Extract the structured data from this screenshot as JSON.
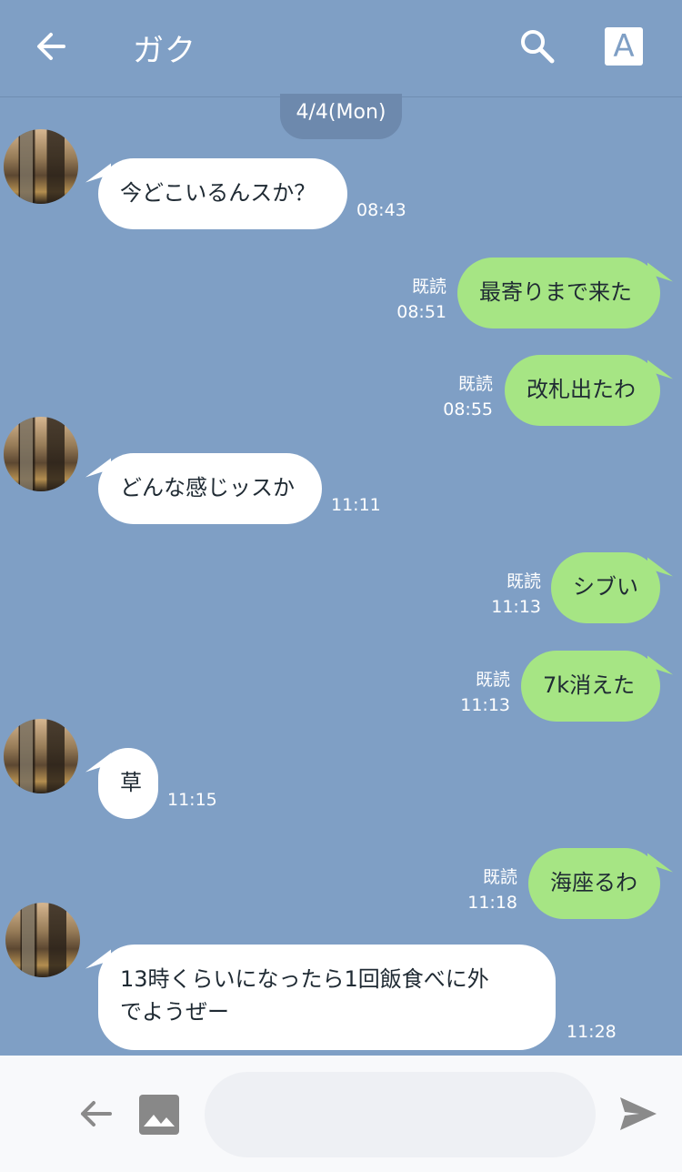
{
  "header": {
    "title": "ガク",
    "font_button_label": "A",
    "back_icon": "arrow-left-icon",
    "search_icon": "search-icon"
  },
  "date_separator": "4/4(Mon)",
  "messages": [
    {
      "side": "in",
      "text": "今どこいるんスか？",
      "time": "08:43"
    },
    {
      "side": "out",
      "text": "最寄りまで来た",
      "read": "既読",
      "time": "08:51"
    },
    {
      "side": "out",
      "text": "改札出たわ",
      "read": "既読",
      "time": "08:55"
    },
    {
      "side": "in",
      "text": "どんな感じッスか",
      "time": "11:11"
    },
    {
      "side": "out",
      "text": "シブい",
      "read": "既読",
      "time": "11:13"
    },
    {
      "side": "out",
      "text": "7k消えた",
      "read": "既読",
      "time": "11:13"
    },
    {
      "side": "in",
      "text": "草",
      "time": "11:15"
    },
    {
      "side": "out",
      "text": "海座るわ",
      "read": "既読",
      "time": "11:18"
    },
    {
      "side": "in",
      "text_lines": [
        "13時くらいになったら1回飯食べに外",
        "でようぜー"
      ],
      "time": "11:28"
    }
  ],
  "footer": {
    "input_placeholder": "",
    "back_icon": "arrow-left-icon",
    "image_icon": "image-icon",
    "send_icon": "send-icon"
  },
  "colors": {
    "background": "#7f9fc5",
    "outgoing_bubble": "#a6e584",
    "incoming_bubble": "#ffffff",
    "footer": "#f8f9fb"
  }
}
